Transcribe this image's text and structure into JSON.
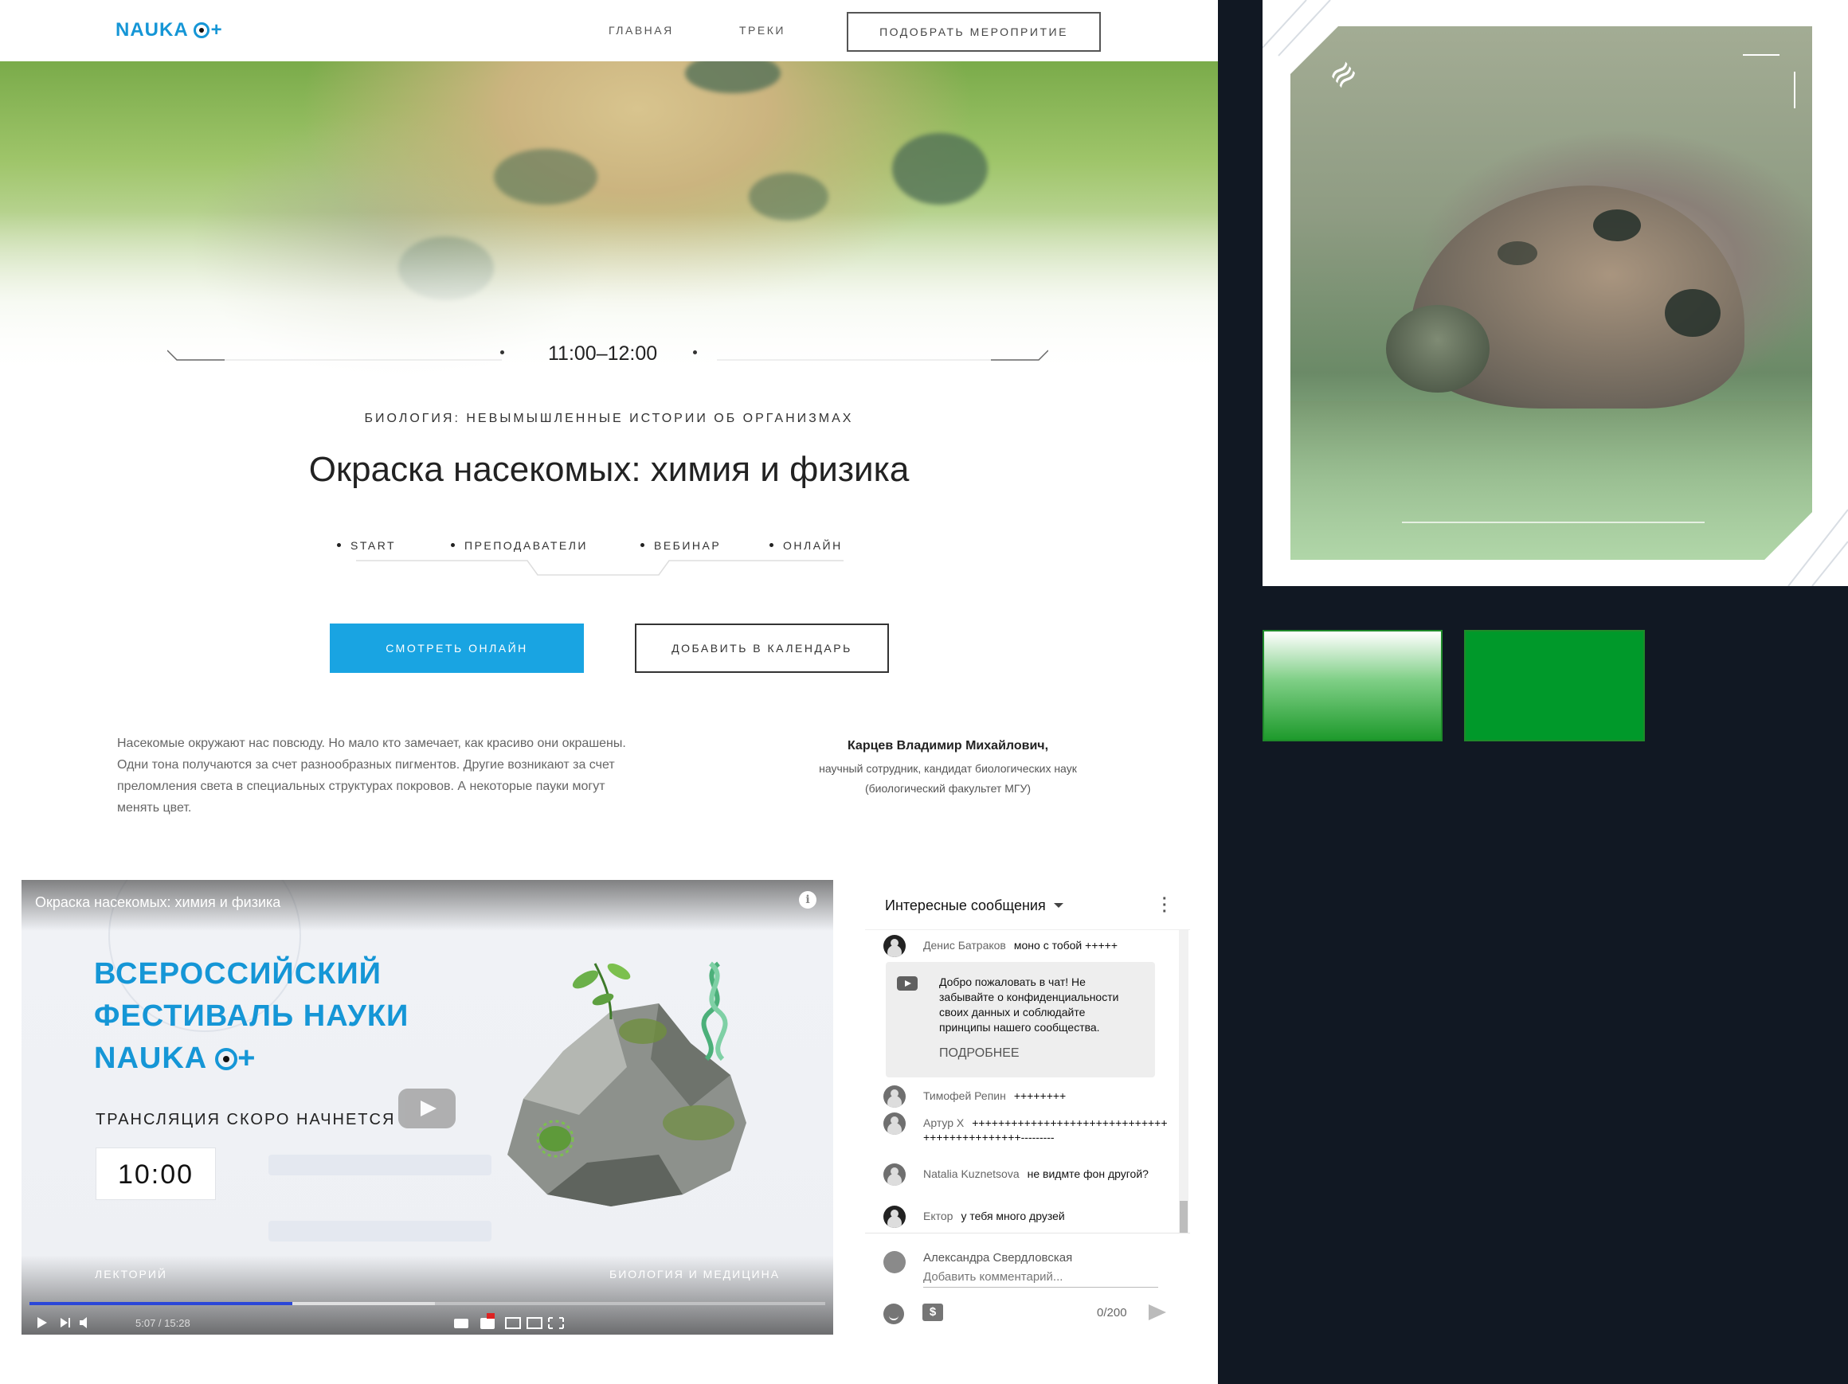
{
  "nav": {
    "logo": "NAUKA",
    "logo_plus": "+",
    "links": [
      "ГЛАВНАЯ",
      "ТРЕКИ"
    ],
    "cta": "ПОДОБРАТЬ МЕРОПРИТИЕ"
  },
  "event": {
    "time": "11:00–12:00",
    "track": "БИОЛОГИЯ: НЕВЫМЫШЛЕННЫЕ ИСТОРИИ ОБ ОРГАНИЗМАХ",
    "title": "Окраска насекомых: химия и физика",
    "tags": [
      "START",
      "ПРЕПОДАВАТЕЛИ",
      "ВЕБИНАР",
      "ОНЛАЙН"
    ],
    "watch_button": "СМОТРЕТЬ ОНЛАЙН",
    "calendar_button": "ДОБАВИТЬ В КАЛЕНДАРЬ",
    "description": "Насекомые окружают нас повсюду. Но мало кто замечает, как красиво они окрашены. Одни тона получаются за счет разнообразных пигментов. Другие возникают за счет преломления света в специальных структурах покровов. А некоторые пауки могут менять цвет.",
    "speaker_name": "Карцев Владимир Михайлович,",
    "speaker_role_1": "научный сотрудник, кандидат биологических наук",
    "speaker_role_2": "(биологический факультет МГУ)"
  },
  "video": {
    "title": "Окраска насекомых: химия и физика",
    "fest_line1": "ВСЕРОССИЙСКИЙ",
    "fest_line2": "ФЕСТИВАЛЬ НАУКИ",
    "fest_line3": "NAUKA",
    "fest_plus": "+",
    "soon": "ТРАНСЛЯЦИЯ СКОРО НАЧНЕТСЯ",
    "countdown": "10:00",
    "label_left": "ЛЕКТОРИЙ",
    "label_right": "БИОЛОГИЯ И МЕДИЦИНА",
    "time": "5:07 / 15:28",
    "progress": 0.33,
    "buffered": 0.51
  },
  "chat": {
    "header": "Интересные сообщения",
    "welcome_text": "Добро пожаловать в чат! Не забывайте о конфиденциальности своих данных и соблюдайте принципы нашего сообщества.",
    "welcome_more": "ПОДРОБНЕЕ",
    "messages": [
      {
        "name": "Денис Батраков",
        "text": "моно с тобой +++++"
      },
      {
        "name": "Тимофей Репин",
        "text": "++++++++"
      },
      {
        "name": "Артур Х",
        "text": "+++++++++++++++++++++++++++++++++++++++++++++---------"
      },
      {
        "name": "Natalia Kuznetsova",
        "text": "не видмте фон другой?"
      },
      {
        "name": "Ектор",
        "text": "у тебя много друзей"
      }
    ],
    "composer_name": "Александра Свердловская",
    "composer_placeholder": "Добавить комментарий...",
    "counter": "0/200",
    "money_icon": "$"
  },
  "colors": {
    "accent": "#19a4e2",
    "swatch_gradient": "linear-gradient(180deg,#ffffff 0%,#7fcf86 45%,#1e9a2c 100%)",
    "swatch_solid": "#00992a",
    "background": "#111823"
  }
}
